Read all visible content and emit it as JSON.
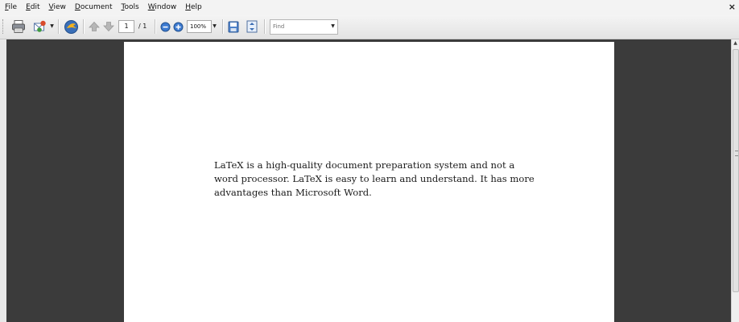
{
  "menu": {
    "items": [
      {
        "mn": "F",
        "rest": "ile"
      },
      {
        "mn": "E",
        "rest": "dit"
      },
      {
        "mn": "V",
        "rest": "iew"
      },
      {
        "mn": "D",
        "rest": "ocument"
      },
      {
        "mn": "T",
        "rest": "ools"
      },
      {
        "mn": "W",
        "rest": "indow"
      },
      {
        "mn": "H",
        "rest": "elp"
      }
    ],
    "close": "×"
  },
  "toolbar": {
    "page_current": "1",
    "page_total": "/ 1",
    "zoom": "100%",
    "find_placeholder": "Find",
    "icons": [
      "print-icon",
      "email-icon",
      "export-icon",
      "previous-page-icon",
      "next-page-icon",
      "zoom-out-icon",
      "zoom-in-icon",
      "save-icon",
      "fit-page-icon"
    ],
    "dropdown_arrow": "▼"
  },
  "document": {
    "body": "LaTeX is a high-quality document preparation system and not a word processor. LaTeX is easy to learn and understand. It has more advantages than Microsoft Word."
  },
  "scrollbar": {
    "up_arrow": "▲"
  }
}
